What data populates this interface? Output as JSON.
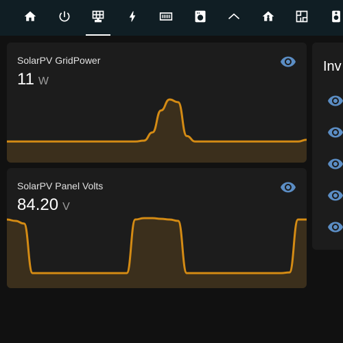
{
  "colors": {
    "topbar_bg": "#101e24",
    "card_bg": "#1c1c1c",
    "accent_line": "#d48b14",
    "accent_fill": "#3b2f1c",
    "icon_active": "#5b8dc4",
    "page_bg": "#111111"
  },
  "topbar": {
    "tabs": [
      {
        "icon": "home-icon",
        "active": false
      },
      {
        "icon": "power-icon",
        "active": false
      },
      {
        "icon": "solar-panel-icon",
        "active": true
      },
      {
        "icon": "lightning-bolt-icon",
        "active": false
      },
      {
        "icon": "radiator-icon",
        "active": false
      },
      {
        "icon": "washing-machine-icon",
        "active": false
      },
      {
        "icon": "roof-icon",
        "active": false
      },
      {
        "icon": "home-upload-icon",
        "active": false
      },
      {
        "icon": "floor-plan-icon",
        "active": false
      },
      {
        "icon": "speaker-icon",
        "active": false
      }
    ]
  },
  "cards": [
    {
      "title": "SolarPV GridPower",
      "value": "11",
      "unit": "W",
      "icon": "eye-icon"
    },
    {
      "title": "SolarPV Panel Volts",
      "value": "84.20",
      "unit": "V",
      "icon": "eye-icon"
    }
  ],
  "right_card": {
    "title": "Inv",
    "row_icons": [
      "eye-icon",
      "eye-icon",
      "eye-icon",
      "eye-icon",
      "eye-icon"
    ]
  },
  "chart_data": [
    {
      "type": "area",
      "series": [
        {
          "values": [
            2,
            2,
            2,
            2,
            2,
            2,
            2,
            2,
            2,
            2,
            2,
            2,
            2,
            2,
            2,
            2,
            3,
            12,
            36,
            48,
            45,
            8,
            2,
            2,
            2,
            2,
            2,
            2,
            2,
            2,
            2,
            2,
            2,
            2,
            2,
            4
          ]
        }
      ]
    },
    {
      "type": "area",
      "series": [
        {
          "values": [
            84,
            82,
            78,
            5,
            5,
            5,
            5,
            5,
            5,
            5,
            5,
            5,
            5,
            5,
            5,
            84,
            86,
            86,
            85,
            84,
            82,
            5,
            5,
            5,
            5,
            5,
            5,
            5,
            5,
            5,
            5,
            5,
            5,
            6,
            84,
            84
          ]
        }
      ]
    }
  ]
}
